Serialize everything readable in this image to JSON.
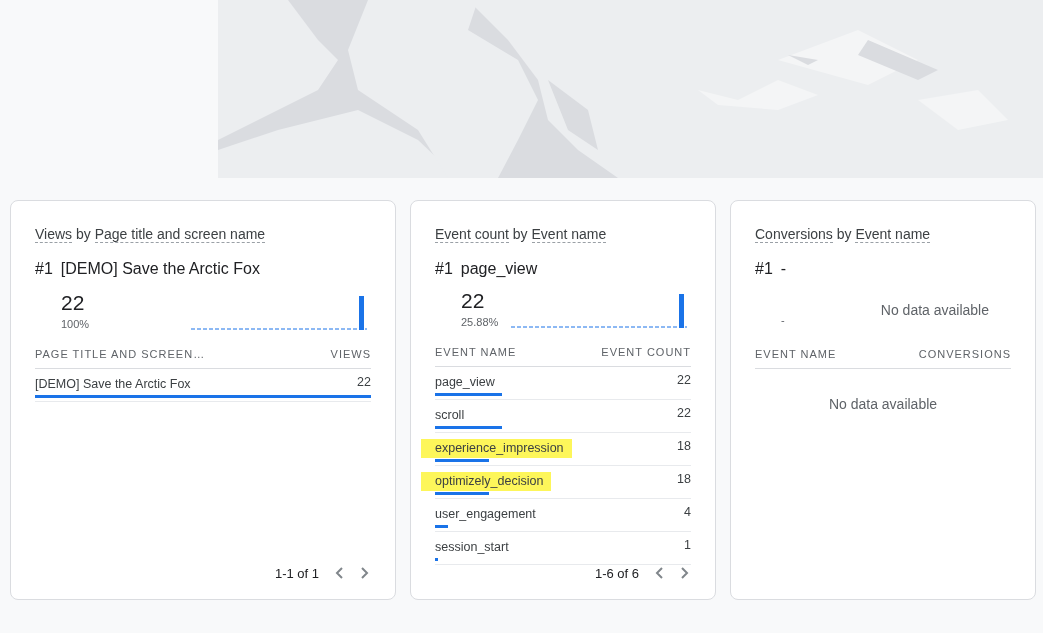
{
  "cards": [
    {
      "title": {
        "metric": "Views",
        "joiner": "by",
        "dimension": "Page title and screen name"
      },
      "top": {
        "rank": "#1",
        "name": "[DEMO] Save the Arctic Fox",
        "value": "22",
        "percent": "100%"
      },
      "sparkline": true,
      "columns": [
        "PAGE TITLE AND SCREEN…",
        "VIEWS"
      ],
      "rows": [
        {
          "name": "[DEMO] Save the Arctic Fox",
          "value": "22",
          "level": 1.0,
          "highlighted": false
        }
      ],
      "pager": {
        "range": "1-1 of 1",
        "prev_disabled": true,
        "next_disabled": true
      }
    },
    {
      "title": {
        "metric": "Event count",
        "joiner": "by",
        "dimension": "Event name"
      },
      "top": {
        "rank": "#1",
        "name": "page_view",
        "value": "22",
        "percent": "25.88%"
      },
      "sparkline": true,
      "columns": [
        "EVENT NAME",
        "EVENT COUNT"
      ],
      "rows": [
        {
          "name": "page_view",
          "value": "22",
          "level": 0.26,
          "highlighted": false
        },
        {
          "name": "scroll",
          "value": "22",
          "level": 0.26,
          "highlighted": false
        },
        {
          "name": "experience_impression",
          "value": "18",
          "level": 0.21,
          "highlighted": true
        },
        {
          "name": "optimizely_decision",
          "value": "18",
          "level": 0.21,
          "highlighted": true
        },
        {
          "name": "user_engagement",
          "value": "4",
          "level": 0.05,
          "highlighted": false
        },
        {
          "name": "session_start",
          "value": "1",
          "level": 0.012,
          "highlighted": false
        }
      ],
      "pager": {
        "range": "1-6 of 6",
        "prev_disabled": true,
        "next_disabled": true
      }
    },
    {
      "title": {
        "metric": "Conversions",
        "joiner": "by",
        "dimension": "Event name"
      },
      "top": {
        "rank": "#1",
        "name": "-",
        "value": "-"
      },
      "sparkline": false,
      "chart_message": "No data available",
      "columns": [
        "EVENT NAME",
        "CONVERSIONS"
      ],
      "table_message": "No data available"
    }
  ]
}
